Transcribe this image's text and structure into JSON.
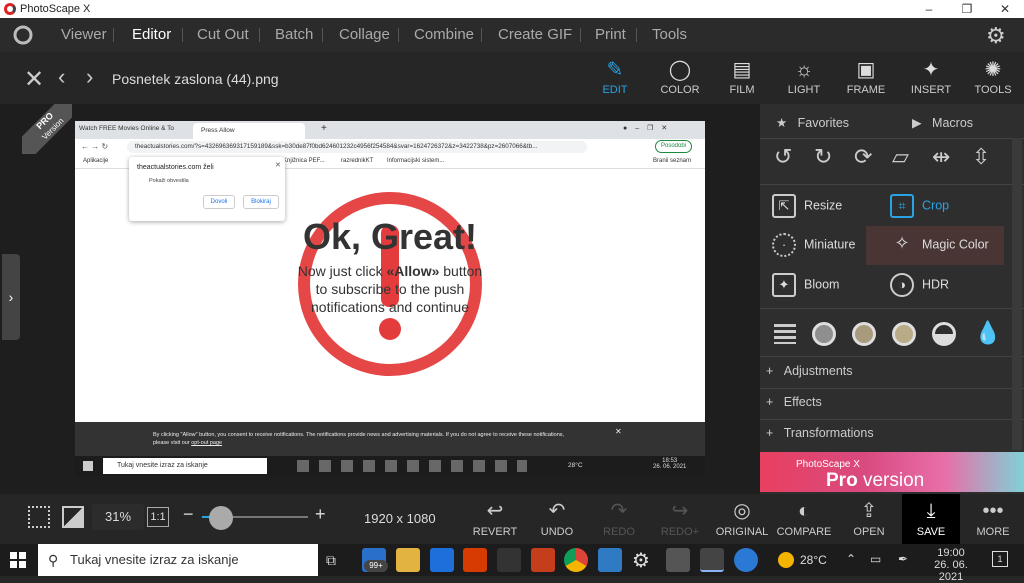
{
  "app": {
    "title": "PhotoScape X",
    "win_min": "–",
    "win_max": "❐",
    "win_close": "✕"
  },
  "menu": [
    {
      "label": "Viewer"
    },
    {
      "label": "Editor"
    },
    {
      "label": "Cut Out"
    },
    {
      "label": "Batch"
    },
    {
      "label": "Collage"
    },
    {
      "label": "Combine"
    },
    {
      "label": "Create GIF"
    },
    {
      "label": "Print"
    },
    {
      "label": "Tools"
    }
  ],
  "file": {
    "name": "Posnetek zaslona (44).png"
  },
  "toolbar": {
    "edit": "EDIT",
    "color": "COLOR",
    "film": "FILM",
    "light": "LIGHT",
    "frame": "FRAME",
    "insert": "INSERT",
    "tools": "TOOLS"
  },
  "badge": {
    "pro": "PRO",
    "version": "Version"
  },
  "browser": {
    "tab1": "Watch FREE Movies Online & To",
    "tab2": "Press Allow",
    "url": "theactualstories.com/?s=432696369317159189&ssk=b30de87f0bd624601232c4956f254584&svar=1624726372&z=3422738&pz=2607066&tb...",
    "update": "Posodobi",
    "bm1": "Aplikacije",
    "bm2": "Knjižnica PEF...",
    "bm3": "razrednikKT",
    "bm4": "Informacijski sistem...",
    "bm5": "Branii seznam",
    "popup_site": "theactualstories.com želi",
    "popup_perm": "Pokaži obvestila",
    "popup_allow": "Dovoli",
    "popup_block": "Blokiraj",
    "headline": "Ok, Great!",
    "sub1": "Now just click ",
    "sub1b": "«Allow»",
    "sub1c": " button",
    "sub2": "to subscribe to the push",
    "sub3": "notifications and continue",
    "notice1": "By clicking \"Allow\" button, you consent to receive notifications. The notifications provide news and advertising materials. If you do not agree to receive these notifications,",
    "notice2": "please visit our ",
    "notice_link": "opt-out page",
    "inner_search": "Tukaj vnesite izraz za iskanje",
    "inner_temp": "28°C",
    "inner_time": "18:53",
    "inner_date": "26. 06. 2021"
  },
  "panel": {
    "favorites": "Favorites",
    "macros": "Macros",
    "resize": "Resize",
    "crop": "Crop",
    "miniature": "Miniature",
    "magic_color": "Magic Color",
    "bloom": "Bloom",
    "hdr": "HDR",
    "adjustments": "Adjustments",
    "effects": "Effects",
    "transformations": "Transformations",
    "ad_top": "PhotoScape X",
    "ad_pro": "Pro",
    "ad_version": " version"
  },
  "bottom": {
    "zoom": "31%",
    "ratio": "1:1",
    "minus": "−",
    "plus": "+",
    "dims": "1920 x 1080",
    "revert": "REVERT",
    "undo": "UNDO",
    "redo": "REDO",
    "redo_plus": "REDO+",
    "original": "ORIGINAL",
    "compare": "COMPARE",
    "open": "OPEN",
    "save": "SAVE",
    "more": "MORE"
  },
  "taskbar": {
    "search": "Tukaj vnesite izraz za iskanje",
    "mail_badge": "99+",
    "temp": "28°C",
    "time": "19:00",
    "date": "26. 06. 2021",
    "notif": "1"
  }
}
